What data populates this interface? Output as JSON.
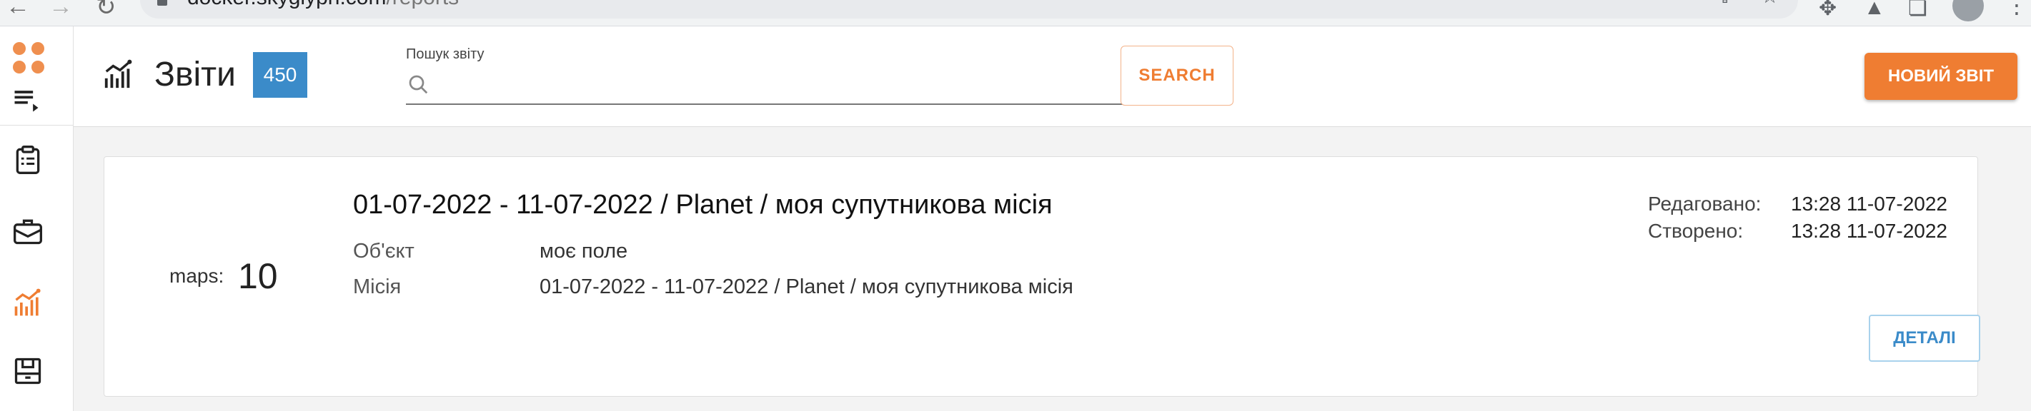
{
  "browser": {
    "url_host": "docker.skyglyph.com",
    "url_path": "/reports"
  },
  "header": {
    "title": "Звіти",
    "count_badge": "450",
    "search_label": "Пошук звіту",
    "search_value": "",
    "search_button": "SEARCH",
    "new_report_button": "НОВИЙ ЗВІТ"
  },
  "sidebar": {
    "items": [
      {
        "icon": "clipboard-icon"
      },
      {
        "icon": "briefcase-icon"
      },
      {
        "icon": "analytics-icon",
        "active": true
      },
      {
        "icon": "archive-icon"
      }
    ]
  },
  "report": {
    "maps_label": "maps:",
    "maps_count": "10",
    "title": "01-07-2022 - 11-07-2022 / Planet / моя супутникова місія",
    "object_label": "Об'єкт",
    "object_value": "моє поле",
    "mission_label": "Місія",
    "mission_value": "01-07-2022 - 11-07-2022 / Planet / моя супутникова місія",
    "edited_label": "Редаговано:",
    "edited_value": "13:28 11-07-2022",
    "created_label": "Створено:",
    "created_value": "13:28 11-07-2022",
    "details_button": "ДЕТАЛІ"
  },
  "colors": {
    "accent": "#ef7d32",
    "badge": "#3b8bc9",
    "details": "#3b8bc9"
  }
}
